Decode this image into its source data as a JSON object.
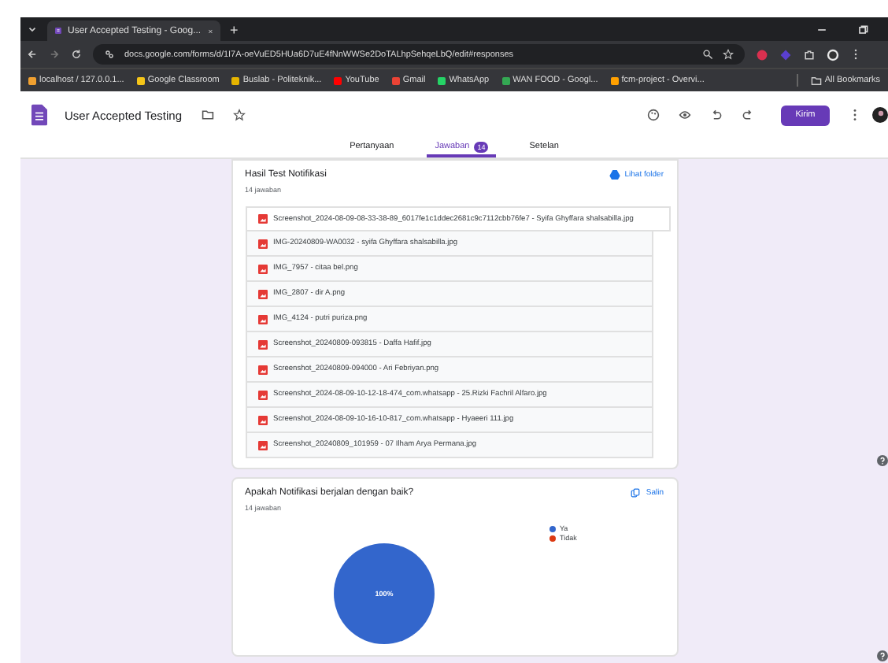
{
  "browser": {
    "tab_title": "User Accepted Testing - Goog...",
    "new_tab": "+",
    "url": "docs.google.com/forms/d/1I7A-oeVuED5HUa6D7uE4fNnWWSe2DoTALhpSehqeLbQ/edit#responses",
    "bookmarks": [
      "localhost / 127.0.0.1...",
      "Google Classroom",
      "Buslab - Politeknik...",
      "YouTube",
      "Gmail",
      "WhatsApp",
      "WAN FOOD - Googl...",
      "fcm-project - Overvi..."
    ],
    "all_bookmarks": "All Bookmarks"
  },
  "form": {
    "title": "User Accepted Testing",
    "send": "Kirim"
  },
  "tabs": [
    {
      "label": "Pertanyaan",
      "selected": false
    },
    {
      "label": "Jawaban",
      "selected": true,
      "badge": "14"
    },
    {
      "label": "Setelan",
      "selected": false
    }
  ],
  "upload_card": {
    "title": "Hasil Test Notifikasi",
    "count": "14 jawaban",
    "link": "Lihat folder",
    "files": [
      "Screenshot_2024-08-09-08-33-38-89_6017fe1c1ddec2681c9c7112cbb76fe7 - Syifa Ghyffara shalsabilla.jpg",
      "IMG-20240809-WA0032 - syifa Ghyffara shalsabilla.jpg",
      "IMG_7957 - citaa bel.png",
      "IMG_2807 - dir A.png",
      "IMG_4124 - putri puriza.png",
      "Screenshot_20240809-093815 - Daffa Hafif.jpg",
      "Screenshot_20240809-094000 - Ari Febriyan.png",
      "Screenshot_2024-08-09-10-12-18-474_com.whatsapp - 25.Rizki Fachril Alfaro.jpg",
      "Screenshot_2024-08-09-10-16-10-817_com.whatsapp - Hyaeeri 111.jpg",
      "Screenshot_20240809_101959 - 07 Ilham Arya Permana.jpg"
    ]
  },
  "chart_card": {
    "title": "Apakah Notifikasi berjalan dengan baik?",
    "count": "14 jawaban",
    "copy": "Salin",
    "chart_data": {
      "type": "pie",
      "categories": [
        "Ya",
        "Tidak"
      ],
      "values": [
        100,
        0
      ],
      "colors": [
        "#3366cc",
        "#dc3912"
      ],
      "value_labels": [
        "100%",
        null
      ]
    }
  }
}
